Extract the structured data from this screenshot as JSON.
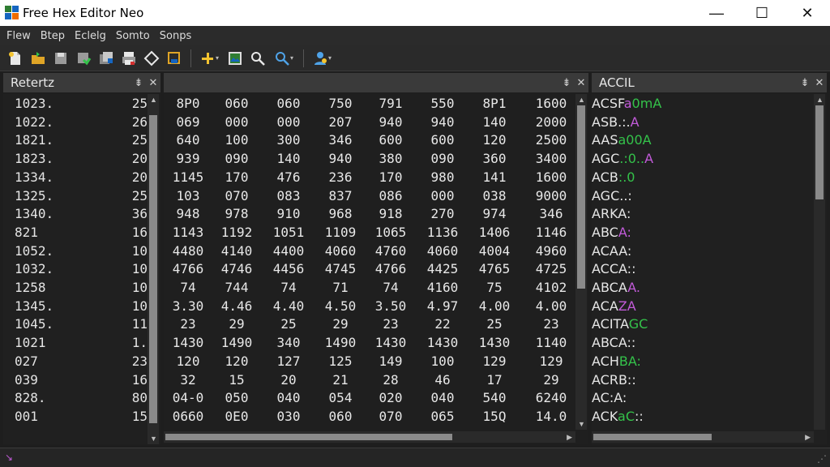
{
  "window": {
    "title": "Free Hex Editor Neo",
    "controls": {
      "minimize": "—",
      "maximize": "☐",
      "close": "✕"
    }
  },
  "menu": [
    "Flew",
    "Btep",
    "Eclelg",
    "Somto",
    "Sonps"
  ],
  "toolbar": {
    "icons": [
      "new-file-icon",
      "open-folder-icon",
      "save-icon",
      "save-green-icon",
      "save-all-icon",
      "print-icon",
      "eraser-icon",
      "save-as-icon",
      "add-icon",
      "image-icon",
      "search-icon",
      "search-dropdown-icon",
      "user-dropdown-icon"
    ]
  },
  "left_panel": {
    "title": "Retertz",
    "rows": [
      {
        "offset": "1023.",
        "count": "25"
      },
      {
        "offset": "1022.",
        "count": "26"
      },
      {
        "offset": "1821.",
        "count": "25"
      },
      {
        "offset": "1823.",
        "count": "20"
      },
      {
        "offset": "1334.",
        "count": "20"
      },
      {
        "offset": "1325.",
        "count": "25"
      },
      {
        "offset": "1340.",
        "count": "36"
      },
      {
        "offset": "821",
        "count": "16"
      },
      {
        "offset": "1052.",
        "count": "10"
      },
      {
        "offset": "1032.",
        "count": "10"
      },
      {
        "offset": "1258",
        "count": "10"
      },
      {
        "offset": "1345.",
        "count": "10"
      },
      {
        "offset": "1045.",
        "count": "11"
      },
      {
        "offset": "1021",
        "count": "1."
      },
      {
        "offset": "027",
        "count": "23"
      },
      {
        "offset": "039",
        "count": "16"
      },
      {
        "offset": "828.",
        "count": "80"
      },
      {
        "offset": "001",
        "count": "15"
      }
    ]
  },
  "hex_panel": {
    "rows": [
      [
        "8P0",
        "060",
        "060",
        "750",
        "791",
        "550",
        "8P1",
        "1600"
      ],
      [
        "069",
        "000",
        "000",
        "207",
        "940",
        "940",
        "140",
        "2000"
      ],
      [
        "640",
        "100",
        "300",
        "346",
        "600",
        "600",
        "120",
        "2500"
      ],
      [
        "939",
        "090",
        "140",
        "940",
        "380",
        "090",
        "360",
        "3400"
      ],
      [
        "1145",
        "170",
        "476",
        "236",
        "170",
        "980",
        "141",
        "1600"
      ],
      [
        "103",
        "070",
        "083",
        "837",
        "086",
        "000",
        "038",
        "9000"
      ],
      [
        "948",
        "978",
        "910",
        "968",
        "918",
        "270",
        "974",
        "346"
      ],
      [
        "1143",
        "1192",
        "1051",
        "1109",
        "1065",
        "1136",
        "1406",
        "1146"
      ],
      [
        "4480",
        "4140",
        "4400",
        "4060",
        "4760",
        "4060",
        "4004",
        "4960"
      ],
      [
        "4766",
        "4746",
        "4456",
        "4745",
        "4766",
        "4425",
        "4765",
        "4725"
      ],
      [
        "74",
        "744",
        "74",
        "71",
        "74",
        "4160",
        "75",
        "4102"
      ],
      [
        "3.30",
        "4.46",
        "4.40",
        "4.50",
        "3.50",
        "4.97",
        "4.00",
        "4.00"
      ],
      [
        "23",
        "29",
        "25",
        "29",
        "23",
        "22",
        "25",
        "23"
      ],
      [
        "1430",
        "1490",
        "340",
        "1490",
        "1430",
        "1430",
        "1430",
        "1140"
      ],
      [
        "120",
        "120",
        "127",
        "125",
        "149",
        "100",
        "129",
        "129"
      ],
      [
        "32",
        "15",
        "20",
        "21",
        "28",
        "46",
        "17",
        "29"
      ],
      [
        "04-0",
        "050",
        "040",
        "054",
        "020",
        "040",
        "540",
        "6240"
      ],
      [
        "0660",
        "0E0",
        "030",
        "060",
        "070",
        "065",
        "15Q",
        "14.0"
      ]
    ]
  },
  "ascii_panel": {
    "title": "ACCIL",
    "rows": [
      [
        {
          "t": "ACSF",
          "c": "w"
        },
        {
          "t": "a",
          "c": "p"
        },
        {
          "t": "0mA",
          "c": "g"
        }
      ],
      [
        {
          "t": "ASB",
          "c": "w"
        },
        {
          "t": ".:.",
          "c": "w"
        },
        {
          "t": "A",
          "c": "p"
        }
      ],
      [
        {
          "t": "AAS",
          "c": "w"
        },
        {
          "t": "a00A",
          "c": "g"
        }
      ],
      [
        {
          "t": "AGC",
          "c": "w"
        },
        {
          "t": ".:0..",
          "c": "g"
        },
        {
          "t": "A",
          "c": "p"
        }
      ],
      [
        {
          "t": "ACB",
          "c": "w"
        },
        {
          "t": ":.0",
          "c": "g"
        }
      ],
      [
        {
          "t": "AGC",
          "c": "w"
        },
        {
          "t": "..:",
          "c": "w"
        }
      ],
      [
        {
          "t": "ARKA:",
          "c": "w"
        }
      ],
      [
        {
          "t": "ABC",
          "c": "w"
        },
        {
          "t": "A:",
          "c": "p"
        }
      ],
      [
        {
          "t": "ACAA:",
          "c": "w"
        }
      ],
      [
        {
          "t": "ACCA::",
          "c": "w"
        }
      ],
      [
        {
          "t": "ABCA",
          "c": "w"
        },
        {
          "t": "A.",
          "c": "p"
        }
      ],
      [
        {
          "t": "ACA",
          "c": "w"
        },
        {
          "t": "ZA",
          "c": "p"
        }
      ],
      [
        {
          "t": "ACIT",
          "c": "w"
        },
        {
          "t": "A",
          "c": "w"
        },
        {
          "t": "GC",
          "c": "g"
        }
      ],
      [
        {
          "t": "ABCA::",
          "c": "w"
        }
      ],
      [
        {
          "t": "ACH",
          "c": "w"
        },
        {
          "t": "BA:",
          "c": "g"
        }
      ],
      [
        {
          "t": "ACRB::",
          "c": "w"
        }
      ],
      [
        {
          "t": "AC:A:",
          "c": "w"
        }
      ],
      [
        {
          "t": "ACK",
          "c": "w"
        },
        {
          "t": "aC",
          "c": "g"
        },
        {
          "t": "::",
          "c": "w"
        }
      ]
    ]
  },
  "colors": {
    "green": "#34c24a",
    "purple": "#c25bd9",
    "background": "#1e1e1e"
  },
  "panel_controls": {
    "pin": "⇟",
    "close": "✕"
  },
  "scroll": {
    "hex_vertical": 0.55,
    "hex_horizontal": 0.65,
    "ascii_vertical": 0.28,
    "ascii_horizontal": 0.55
  }
}
